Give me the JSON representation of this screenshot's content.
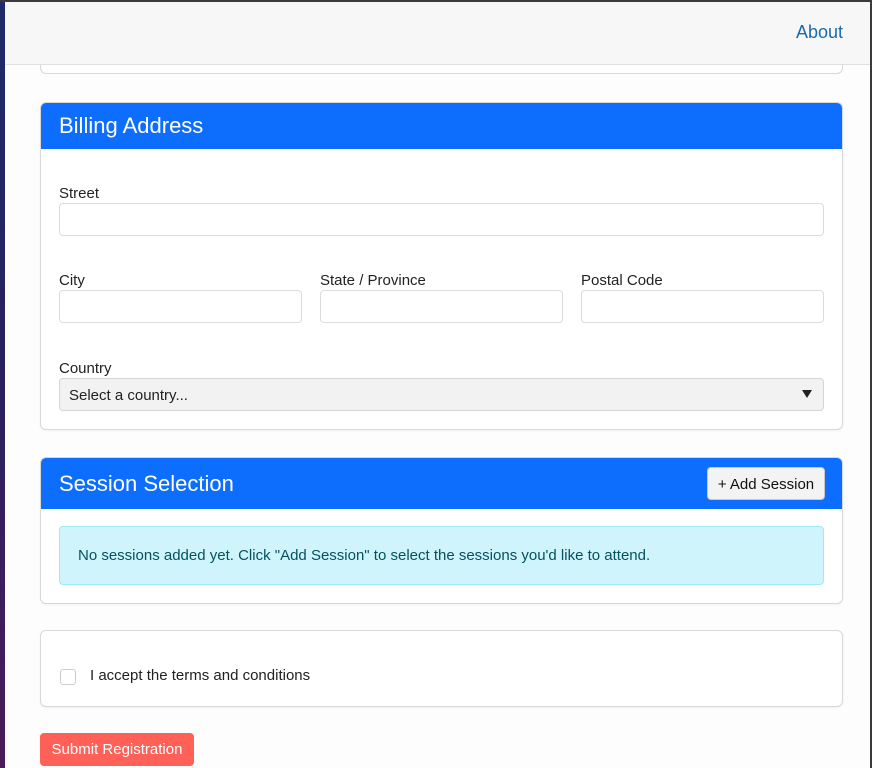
{
  "nav": {
    "about_label": "About"
  },
  "billing": {
    "title": "Billing Address",
    "street_label": "Street",
    "city_label": "City",
    "state_label": "State / Province",
    "postal_label": "Postal Code",
    "country_label": "Country",
    "country_selected": "Select a country..."
  },
  "sessions": {
    "title": "Session Selection",
    "add_label": "+ Add Session",
    "empty_message": "No sessions added yet. Click \"Add Session\" to select the sessions you'd like to attend."
  },
  "terms": {
    "label": "I accept the terms and conditions"
  },
  "submit_label": "Submit Registration",
  "colors": {
    "header_blue": "#0d6efd",
    "info_bg": "#cff4fc",
    "submit_red": "#ff6058",
    "link_blue": "#1a6aaf"
  }
}
